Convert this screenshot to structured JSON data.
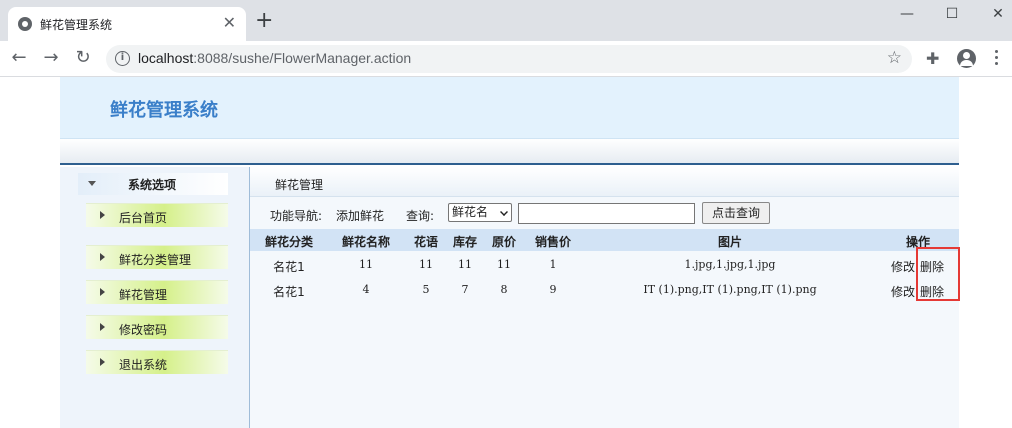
{
  "browser": {
    "tab_title": "鲜花管理系统",
    "tab_close": "✕",
    "new_tab": "+",
    "url_host": "localhost",
    "url_rest": ":8088/sushe/FlowerManager.action",
    "win_min": "—",
    "win_max": "☐",
    "win_close": "✕",
    "back": "←",
    "forward": "→",
    "reload": "↻",
    "info": "i",
    "star": "☆",
    "extensions": "✚"
  },
  "header": {
    "title": "鲜花管理系统"
  },
  "sidebar": {
    "heading": "系统选项",
    "items": [
      "后台首页",
      "鲜花分类管理",
      "鲜花管理",
      "修改密码",
      "退出系统"
    ]
  },
  "content": {
    "heading": "鲜花管理",
    "func_nav_label": "功能导航:",
    "add_link": "添加鲜花",
    "query_label": "查询:",
    "select_value": "鲜花名",
    "query_placeholder": "",
    "query_button": "点击查询"
  },
  "table": {
    "columns": [
      "鲜花分类",
      "鲜花名称",
      "花语",
      "库存",
      "原价",
      "销售价",
      "图片",
      "操作"
    ],
    "rows": [
      {
        "category": "名花1",
        "name": "11",
        "language": "11",
        "stock": "11",
        "price": "11",
        "sale": "1",
        "images": "1.jpg,1.jpg,1.jpg",
        "edit": "修改",
        "delete": "删除"
      },
      {
        "category": "名花1",
        "name": "4",
        "language": "5",
        "stock": "7",
        "price": "8",
        "sale": "9",
        "images": "IT (1).png,IT (1).png,IT (1).png",
        "edit": "修改",
        "delete": "删除"
      }
    ]
  },
  "colors": {
    "highlight": "#e53935",
    "header_title": "#3a7fc9"
  }
}
